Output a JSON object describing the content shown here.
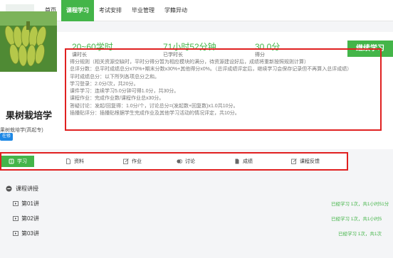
{
  "nav": {
    "items": [
      {
        "label": "首页",
        "active": false
      },
      {
        "label": "课程学习",
        "active": true
      },
      {
        "label": "考试安排",
        "active": false
      },
      {
        "label": "毕业管理",
        "active": false
      },
      {
        "label": "学籍异动",
        "active": false
      }
    ]
  },
  "course": {
    "title": "果树栽培学",
    "subtitle": "果树栽培学(高起专)",
    "tag": "在修"
  },
  "stats": [
    {
      "value": "20~60学时",
      "label": "课时长"
    },
    {
      "value": "71小时52分钟",
      "label": "已学时长"
    },
    {
      "value": "30.0分",
      "label": "得分"
    }
  ],
  "continue_button": "继续学习",
  "rules": [
    "得分规则（相关资源空缺时，平时分得分暂为相应模块的满分，待资源建设好后，成绩将重新按照规则计算）",
    "总评分数：总平时成绩总分x70%+期末分数x30%+其他得分x0%。（总评成绩评定后，继续学习会保存记录但不再算入总评成绩）",
    "平时成绩总分：以下所列各项总分之和。",
    "学习登录：2.0分/次，共20分。",
    "课件学习：连续学习5.0分钟可得1.0分，共30分。",
    "课程作业：完成作业数/课程作业总x30分。",
    "答疑讨论：发起/回复得：1.0分/个，讨论总分=(发起数+回复数)x1.0共10分。",
    "插播贴评分：插播贴根据学生完成作业及其他学习活动的情况评定，共10分。"
  ],
  "tabs": [
    {
      "label": "学习",
      "icon": "study-icon",
      "active": true
    },
    {
      "label": "资料",
      "icon": "file-icon",
      "active": false
    },
    {
      "label": "作业",
      "icon": "edit-icon",
      "active": false
    },
    {
      "label": "讨论",
      "icon": "discuss-icon",
      "active": false
    },
    {
      "label": "成绩",
      "icon": "score-icon",
      "active": false
    },
    {
      "label": "课程反馈",
      "icon": "feedback-icon",
      "active": false
    }
  ],
  "lecture_section": {
    "title": "课程讲授",
    "icon": "minus-circle-icon"
  },
  "lectures": [
    {
      "label": "第01讲",
      "progress": "已经学习 1次，共1小时51分"
    },
    {
      "label": "第02讲",
      "progress": "已经学习 1次，共1小时5"
    },
    {
      "label": "第03讲",
      "progress": "已经学习 1次，共1次"
    }
  ],
  "colors": {
    "accent": "#44b549",
    "highlight": "#e02020",
    "tag": "#1e88e5"
  }
}
